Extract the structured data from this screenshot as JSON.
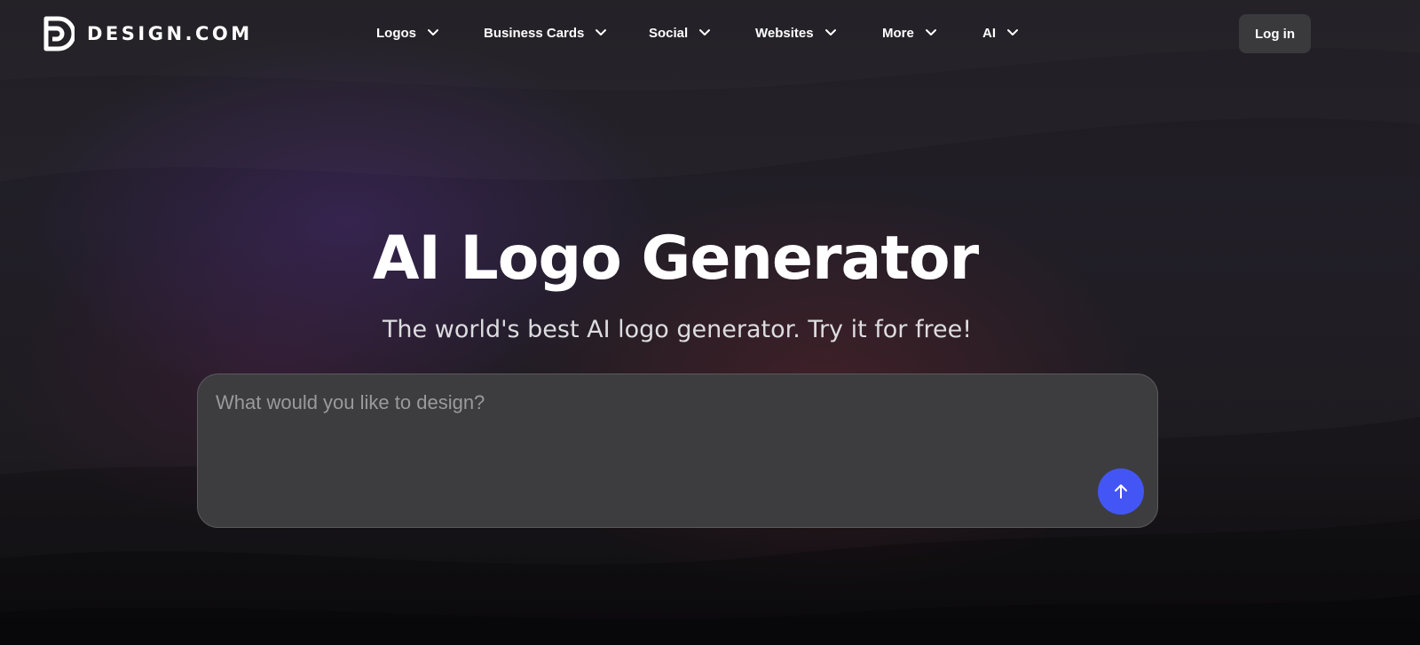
{
  "header": {
    "brand_name": "DESIGN.COM",
    "nav": [
      {
        "label": "Logos",
        "icon": "chevron-down-icon"
      },
      {
        "label": "Business Cards",
        "icon": "chevron-down-icon"
      },
      {
        "label": "Social",
        "icon": "chevron-down-icon"
      },
      {
        "label": "Websites",
        "icon": "chevron-down-icon"
      },
      {
        "label": "More",
        "icon": "chevron-down-icon"
      },
      {
        "label": "AI",
        "icon": "chevron-down-icon"
      }
    ],
    "login_label": "Log in"
  },
  "hero": {
    "title": "AI Logo Generator",
    "subtitle": "The world's best AI logo generator. Try it for free!",
    "prompt_placeholder": "What would you like to design?",
    "prompt_value": "",
    "submit_icon": "arrow-up-icon"
  },
  "colors": {
    "background": "#1e1b22",
    "accent": "#4356f5",
    "input_bg": "#3d3d3f",
    "login_bg": "#3a3a3d"
  }
}
